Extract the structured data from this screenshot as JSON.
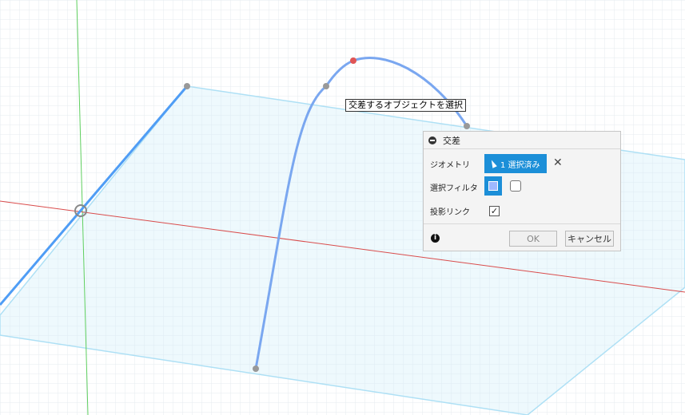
{
  "tooltip": "交差するオブジェクトを選択",
  "panel": {
    "title": "交差",
    "geometry_label": "ジオメトリ",
    "geometry_button": "1 選択済み",
    "filter_label": "選択フィルタ",
    "projection_link_label": "投影リンク",
    "projection_link_checked": true,
    "ok_label": "OK",
    "cancel_label": "キャンセル"
  },
  "icons": [
    "collapse-icon",
    "cursor-icon",
    "clear-icon",
    "filter-face-icon",
    "filter-body-icon",
    "info-icon"
  ],
  "colors": {
    "grid": "#dbe3ea",
    "curve": "#7aa7f0",
    "selected_line": "#4f9df5",
    "plane_outline": "#aee0f5",
    "x_axis": "#d94b4b",
    "y_axis": "#5fcf5f",
    "accent": "#1c8fd8"
  }
}
